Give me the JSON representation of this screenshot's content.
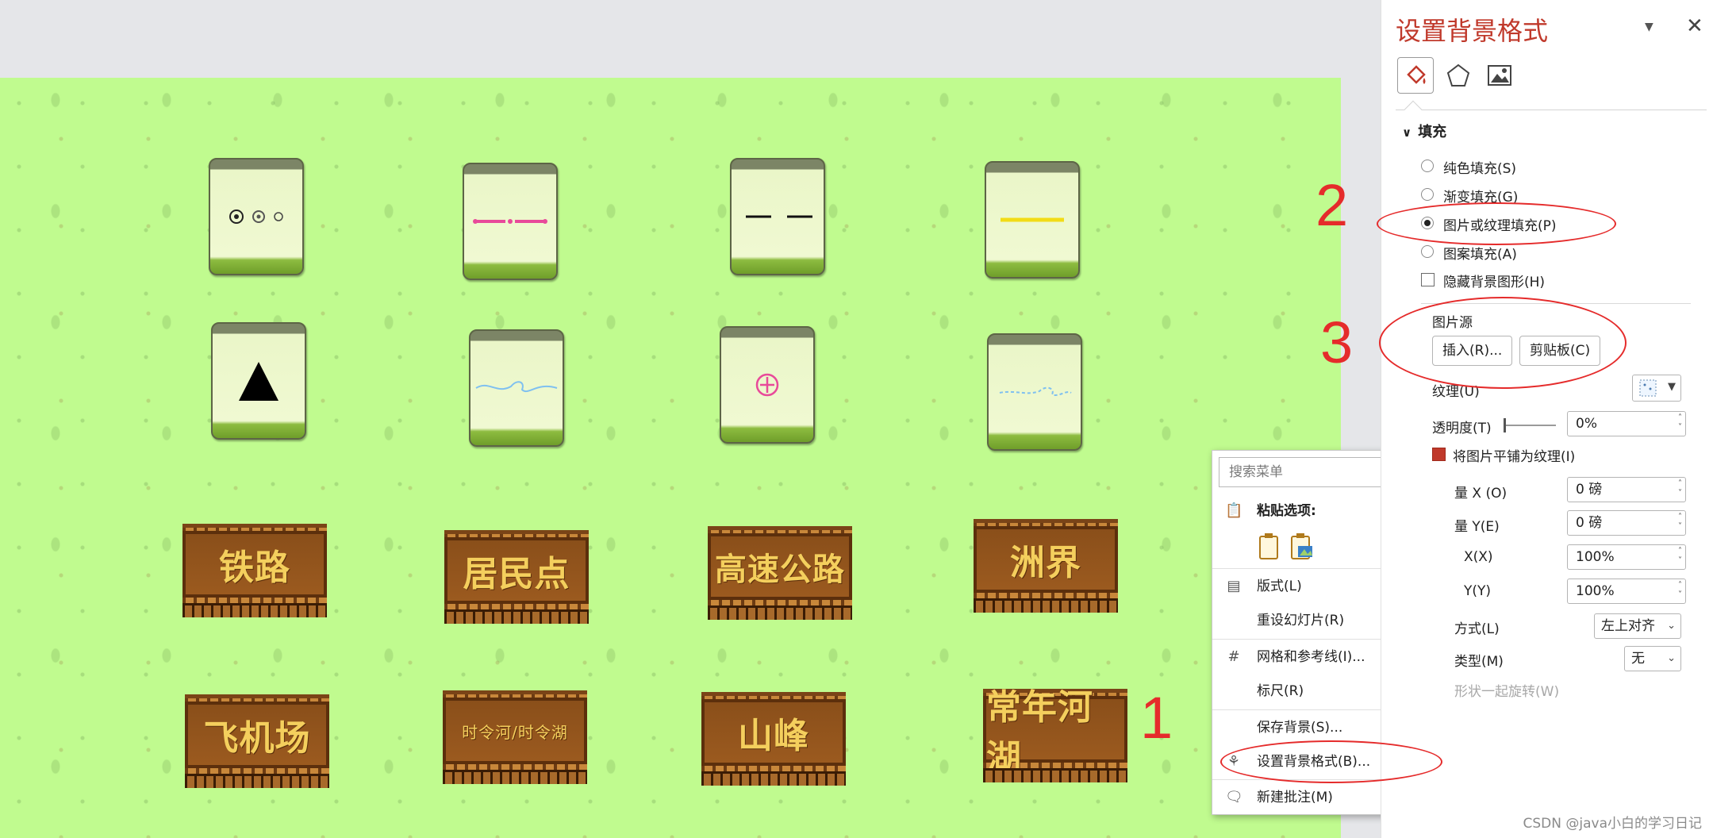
{
  "slide": {
    "tiles_row1": [
      "dots-symbol",
      "pink-dashed-line-symbol",
      "black-dashed-line-symbol",
      "yellow-line-symbol"
    ],
    "tiles_row2": [
      "triangle-symbol",
      "blue-river-symbol",
      "airport-symbol",
      "blue-dashed-river-symbol"
    ],
    "signs_row3": [
      "铁路",
      "居民点",
      "高速公路",
      "洲界"
    ],
    "signs_row4": [
      "飞机场",
      "时令河/时令湖",
      "山峰",
      "常年河湖"
    ]
  },
  "annotations": {
    "step1": "1",
    "step2": "2",
    "step3": "3"
  },
  "context_menu": {
    "search_placeholder": "搜索菜单",
    "paste_header": "粘贴选项:",
    "layout": "版式(L)",
    "reset_slide": "重设幻灯片(R)",
    "grid_guides": "网格和参考线(I)...",
    "ruler": "标尺(R)",
    "save_background": "保存背景(S)...",
    "format_background": "设置背景格式(B)...",
    "new_comment": "新建批注(M)"
  },
  "pane": {
    "title": "设置背景格式",
    "fill_section": "填充",
    "solid_fill": "纯色填充(S)",
    "gradient_fill": "渐变填充(G)",
    "picture_fill": "图片或纹理填充(P)",
    "pattern_fill": "图案填充(A)",
    "hide_background_graphics": "隐藏背景图形(H)",
    "picture_source": "图片源",
    "insert_button": "插入(R)...",
    "clipboard_button": "剪贴板(C)",
    "texture_label": "纹理(U)",
    "transparency_label": "透明度(T)",
    "transparency_value": "0%",
    "tile_checkbox": "将图片平铺为纹理(I)",
    "offset_x_label": "量 X (O)",
    "offset_x_value": "0 磅",
    "offset_y_label": "量 Y(E)",
    "offset_y_value": "0 磅",
    "scale_x_label": "X(X)",
    "scale_x_value": "100%",
    "scale_y_label": "Y(Y)",
    "scale_y_value": "100%",
    "alignment_label": "方式(L)",
    "alignment_value": "左上对齐",
    "mirror_label": "类型(M)",
    "mirror_value": "无",
    "rotate_label": "形状一起旋转(W)"
  },
  "watermark": "CSDN @java小白的学习日记",
  "colors": {
    "accent_red": "#e52b2b",
    "slide_green": "#c0fb8f",
    "title_red": "#c0392b"
  }
}
